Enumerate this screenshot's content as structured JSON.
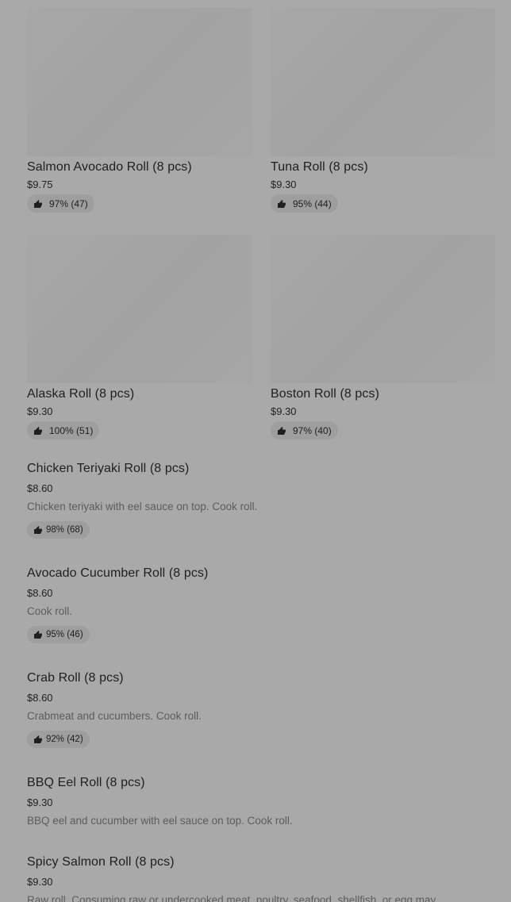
{
  "grid": [
    {
      "name": "Salmon Avocado Roll (8 pcs)",
      "price": "$9.75",
      "rating": "97% (47)"
    },
    {
      "name": "Tuna Roll (8 pcs)",
      "price": "$9.30",
      "rating": "95% (44)"
    },
    {
      "name": "Alaska Roll (8 pcs)",
      "price": "$9.30",
      "rating": "100% (51)"
    },
    {
      "name": "Boston Roll (8 pcs)",
      "price": "$9.30",
      "rating": "97% (40)"
    }
  ],
  "list": [
    {
      "name": "Chicken Teriyaki Roll (8 pcs)",
      "price": "$8.60",
      "description": "Chicken teriyaki with eel sauce on top. Cook roll.",
      "rating": "98% (68)"
    },
    {
      "name": "Avocado Cucumber Roll (8 pcs)",
      "price": "$8.60",
      "description": "Cook roll.",
      "rating": "95% (46)"
    },
    {
      "name": "Crab Roll (8 pcs)",
      "price": "$8.60",
      "description": "Crabmeat and cucumbers. Cook roll.",
      "rating": "92% (42)"
    },
    {
      "name": "BBQ Eel Roll (8 pcs)",
      "price": "$9.30",
      "description": "BBQ eel and cucumber with eel sauce on top. Cook roll.",
      "rating": ""
    },
    {
      "name": "Spicy Salmon Roll (8 pcs)",
      "price": "$9.30",
      "description": "Raw roll. Consuming raw or undercooked meat, poultry, seafood, shellfish, or egg may",
      "rating": ""
    }
  ],
  "icons": {
    "rating": "thumbs-up-icon"
  },
  "colors": {
    "overlay": "#a9a9a9",
    "badge": "#9e9e9e"
  }
}
